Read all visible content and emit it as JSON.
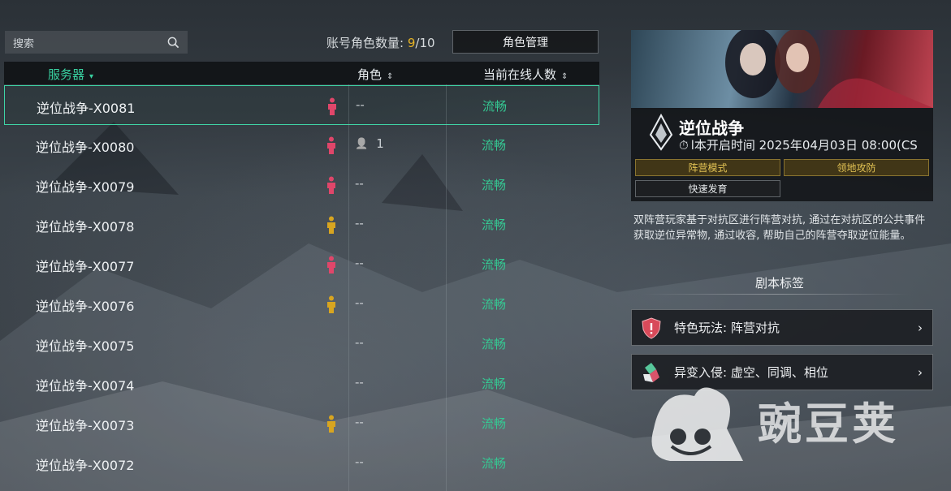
{
  "search": {
    "placeholder": "搜索"
  },
  "account": {
    "label": "账号角色数量: ",
    "current": "9",
    "sep": "/",
    "max": "10",
    "manage_button": "角色管理"
  },
  "table": {
    "headers": {
      "server": "服务器",
      "role": "角色",
      "online": "当前在线人数"
    },
    "rows": [
      {
        "name": "逆位战争-X0081",
        "camp": "red",
        "role": "--",
        "status": "流畅"
      },
      {
        "name": "逆位战争-X0080",
        "camp": "red",
        "role": "1",
        "status": "流畅"
      },
      {
        "name": "逆位战争-X0079",
        "camp": "red",
        "role": "--",
        "status": "流畅"
      },
      {
        "name": "逆位战争-X0078",
        "camp": "gold",
        "role": "--",
        "status": "流畅"
      },
      {
        "name": "逆位战争-X0077",
        "camp": "red",
        "role": "--",
        "status": "流畅"
      },
      {
        "name": "逆位战争-X0076",
        "camp": "gold",
        "role": "--",
        "status": "流畅"
      },
      {
        "name": "逆位战争-X0075",
        "camp": "",
        "role": "--",
        "status": "流畅"
      },
      {
        "name": "逆位战争-X0074",
        "camp": "",
        "role": "--",
        "status": "流畅"
      },
      {
        "name": "逆位战争-X0073",
        "camp": "gold",
        "role": "--",
        "status": "流畅"
      },
      {
        "name": "逆位战争-X0072",
        "camp": "",
        "role": "--",
        "status": "流畅"
      }
    ]
  },
  "server_info": {
    "title": "逆位战争",
    "open_time": "l本开启时间 2025年04月03日 08:00(CS",
    "tags": [
      "阵营模式",
      "领地攻防",
      "快速发育"
    ],
    "description": "双阵营玩家基于对抗区进行阵营对抗, 通过在对抗区的公共事件获取逆位异常物, 通过收容, 帮助自己的阵营夺取逆位能量。",
    "tags_section_title": "剧本标签",
    "features": [
      {
        "label": "特色玩法: 阵营对抗",
        "icon": "shield-icon"
      },
      {
        "label": "异变入侵: 虚空、同调、相位",
        "icon": "crystal-icon"
      }
    ]
  },
  "watermark": {
    "text": "豌豆荚"
  },
  "colors": {
    "accent": "#39d0a0",
    "red_camp": "#e0466a",
    "gold_camp": "#d8a520",
    "count": "#e6b325"
  }
}
